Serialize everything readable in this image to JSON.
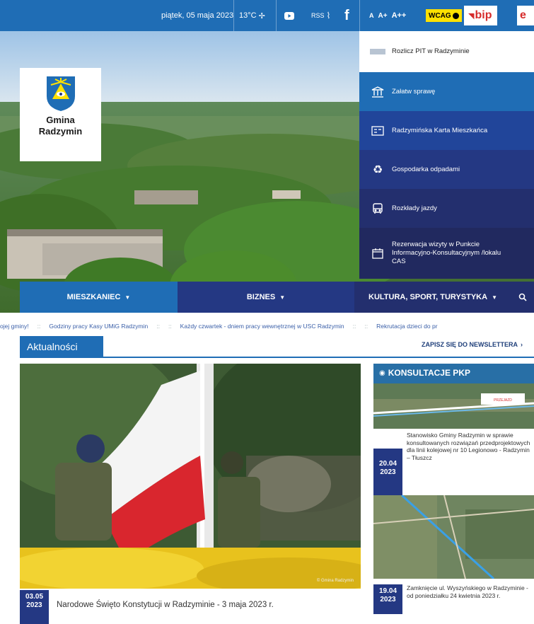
{
  "topbar": {
    "date": "piątek, 05 maja 2023",
    "weather": "13°C",
    "youtube_icon": "youtube-icon",
    "rss_label": "RSS",
    "facebook_label": "f",
    "font_sizes": [
      "A",
      "A+",
      "A++"
    ],
    "wcag_label": "WCAG",
    "bip_label": "bip",
    "epuap_label": "e"
  },
  "logo": {
    "line1": "Gmina",
    "line2": "Radzymin"
  },
  "quick_menu": [
    {
      "label": "Rozlicz PIT w Radzyminie",
      "icon": "pit-icon"
    },
    {
      "label": "Załatw sprawę",
      "icon": "bank-icon"
    },
    {
      "label": "Radzymińska Karta Mieszkańca",
      "icon": "card-icon"
    },
    {
      "label": "Gospodarka odpadami",
      "icon": "recycle-icon"
    },
    {
      "label": "Rozkłady jazdy",
      "icon": "bus-icon"
    },
    {
      "label": "Rezerwacja wizyty w Punkcie Informacyjno-Konsultacyjnym /lokalu CAS",
      "icon": "calendar-icon"
    }
  ],
  "main_nav": {
    "items": [
      "MIESZKANIEC",
      "BIZNES",
      "KULTURA, SPORT, TURYSTYKA"
    ],
    "search_icon": "search-icon"
  },
  "ticker": [
    "ojej gminy!",
    "Godziny pracy Kasy UMiG Radzymin",
    "Każdy czwartek - dniem pracy wewnętrznej w USC Radzymin",
    "Rekrutacja dzieci do pr"
  ],
  "news": {
    "tab_label": "Aktualności",
    "newsletter_label": "ZAPISZ SIĘ DO NEWSLETTERA",
    "main_article": {
      "date_day": "03.05",
      "date_year": "2023",
      "title": "Narodowe Święto Konstytucji w Radzyminie - 3 maja 2023 r.",
      "photo_credit": "© Gmina Radzymin"
    },
    "side_articles": [
      {
        "overlay_title": "KONSULTACJE PKP",
        "date_day": "20.04",
        "date_year": "2023",
        "caption": "Stanowisko Gminy Radzymin w sprawie konsultowanych rozwiązań przedprojektowych dla linii kolejowej nr 10 Legionowo - Radzymin – Tłuszcz"
      },
      {
        "date_day": "19.04",
        "date_year": "2023",
        "caption": "Zamknięcie ul. Wyszyńskiego w Radzyminie - od poniedziałku 24 kwietnia 2023 r."
      }
    ]
  },
  "colors": {
    "primary_blue": "#1f6db5",
    "navy": "#243883",
    "dark_navy": "#232f6e",
    "wcag_yellow": "#ffe100",
    "bip_red": "#d62b2b"
  }
}
